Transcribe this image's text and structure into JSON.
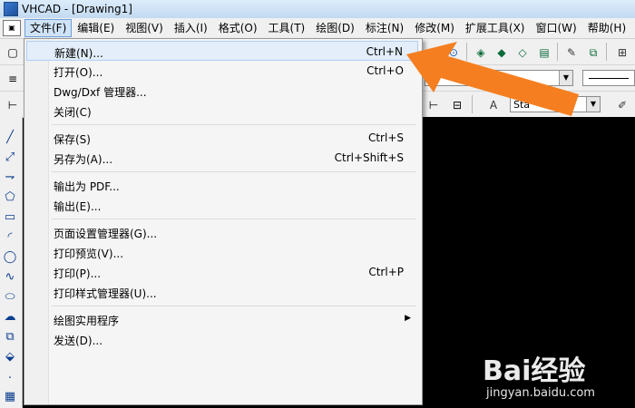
{
  "window": {
    "title": "VHCAD - [Drawing1]"
  },
  "menubar": {
    "items": [
      {
        "label": "文件(F)",
        "active": true
      },
      {
        "label": "编辑(E)"
      },
      {
        "label": "视图(V)"
      },
      {
        "label": "插入(I)"
      },
      {
        "label": "格式(O)"
      },
      {
        "label": "工具(T)"
      },
      {
        "label": "绘图(D)"
      },
      {
        "label": "标注(N)"
      },
      {
        "label": "修改(M)"
      },
      {
        "label": "扩展工具(X)"
      },
      {
        "label": "窗口(W)"
      },
      {
        "label": "帮助(H)"
      }
    ]
  },
  "toolbar": {
    "combo_text_style": "Sta",
    "icons": [
      "zoom-in-icon",
      "zoom-window-icon",
      "layer-icon",
      "block-icon",
      "match-icon",
      "properties-icon",
      "grid-icon"
    ]
  },
  "file_menu": {
    "items": [
      {
        "label": "新建(N)...",
        "shortcut": "Ctrl+N"
      },
      {
        "label": "打开(O)...",
        "shortcut": "Ctrl+O"
      },
      {
        "label": "Dwg/Dxf 管理器...",
        "shortcut": ""
      },
      {
        "label": "关闭(C)",
        "shortcut": ""
      },
      {
        "label": "保存(S)",
        "shortcut": "Ctrl+S"
      },
      {
        "label": "另存为(A)...",
        "shortcut": "Ctrl+Shift+S"
      },
      {
        "label": "输出为 PDF...",
        "shortcut": ""
      },
      {
        "label": "输出(E)...",
        "shortcut": ""
      },
      {
        "label": "页面设置管理器(G)...",
        "shortcut": ""
      },
      {
        "label": "打印预览(V)...",
        "shortcut": ""
      },
      {
        "label": "打印(P)...",
        "shortcut": "Ctrl+P"
      },
      {
        "label": "打印样式管理器(U)...",
        "shortcut": ""
      },
      {
        "label": "绘图实用程序",
        "shortcut": "",
        "submenu": true
      },
      {
        "label": "发送(D)...",
        "shortcut": ""
      }
    ]
  },
  "watermark": {
    "brand": "Bai经验",
    "url": "jingyan.baidu.com"
  },
  "colors": {
    "annotation_arrow": "#f57f20",
    "menu_hover": "#e3eefa",
    "canvas": "#000000"
  }
}
